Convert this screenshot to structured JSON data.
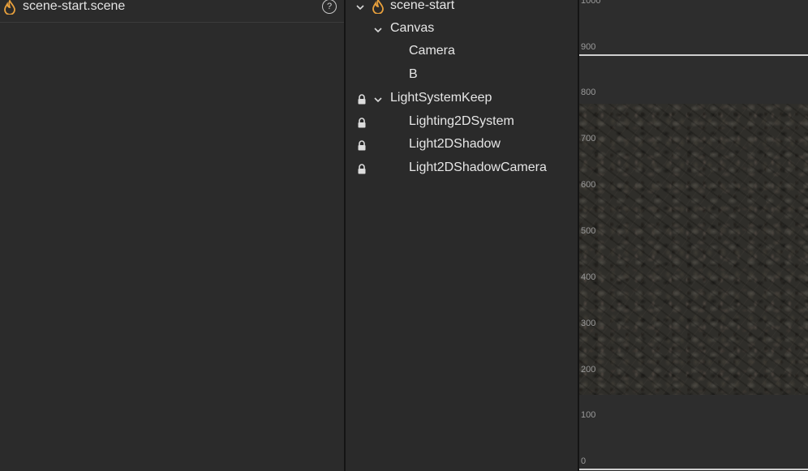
{
  "inspector": {
    "title": "scene-start.scene",
    "help_glyph": "?"
  },
  "hierarchy": {
    "nodes": [
      {
        "label": "scene-start",
        "expanded": true,
        "locked": false,
        "icon": "scene-icon"
      },
      {
        "label": "Canvas",
        "expanded": true,
        "locked": false
      },
      {
        "label": "Camera",
        "locked": false
      },
      {
        "label": "B",
        "locked": false
      },
      {
        "label": "LightSystemKeep",
        "expanded": true,
        "locked": true
      },
      {
        "label": "Lighting2DSystem",
        "locked": true
      },
      {
        "label": "Light2DShadow",
        "locked": true
      },
      {
        "label": "Light2DShadowCamera",
        "locked": true
      }
    ]
  },
  "scene_view": {
    "ruler_labels": [
      "1000",
      "900",
      "800",
      "700",
      "600",
      "500",
      "400",
      "300",
      "200",
      "100",
      "0"
    ]
  },
  "colors": {
    "scene_icon": "#e8a03c",
    "panel_bg": "#2a2a2a",
    "text": "#e6e6e6"
  }
}
